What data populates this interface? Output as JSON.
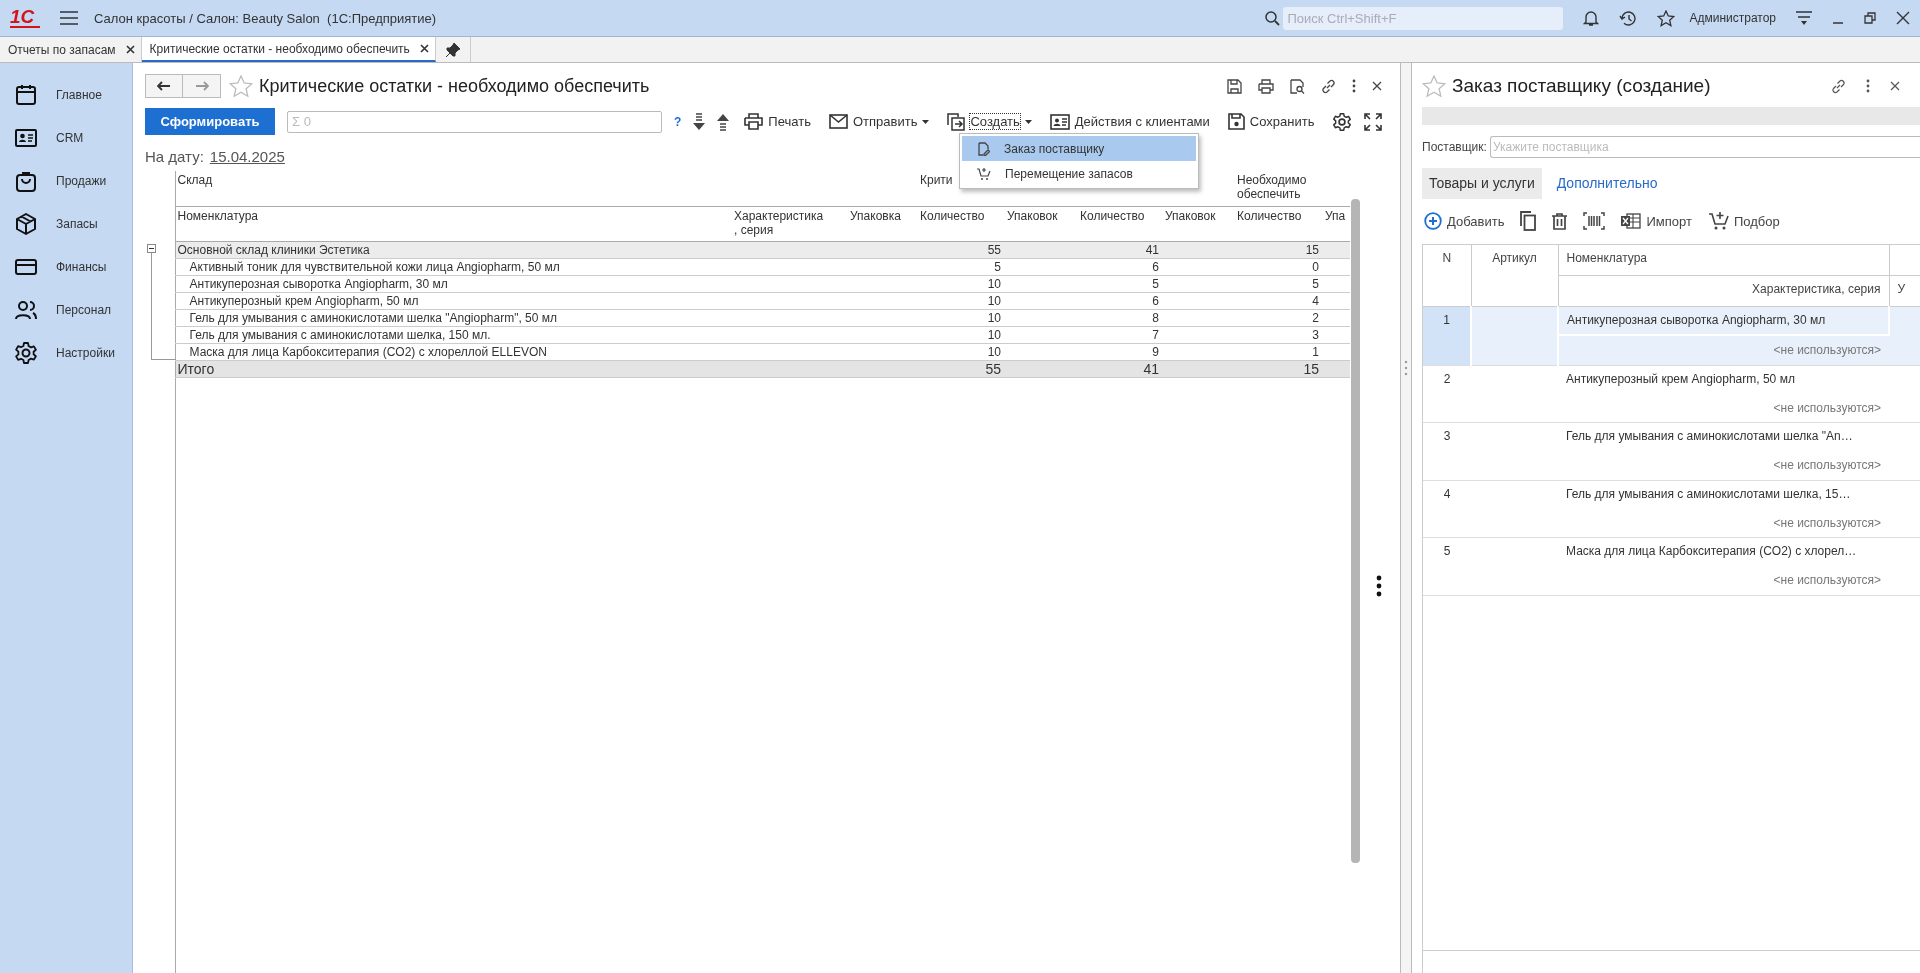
{
  "app": {
    "logo": "1С",
    "title": "Салон красоты / Салон: Beauty Salon  (1С:Предприятие)",
    "search_placeholder": "Поиск Ctrl+Shift+F",
    "user": "Администратор"
  },
  "open_tabs": [
    {
      "label": "Отчеты по запасам",
      "selected": false
    },
    {
      "label": "Критические остатки - необходимо обеспечить",
      "selected": true
    }
  ],
  "sidebar": {
    "items": [
      {
        "label": "Главное"
      },
      {
        "label": "CRM"
      },
      {
        "label": "Продажи"
      },
      {
        "label": "Запасы"
      },
      {
        "label": "Финансы"
      },
      {
        "label": "Персонал"
      },
      {
        "label": "Настройки"
      }
    ]
  },
  "report": {
    "title": "Критические остатки - необходимо обеспечить",
    "generate_button": "Сформировать",
    "sum_placeholder": "Σ 0",
    "help": "?",
    "toolbar": [
      {
        "kind": "print",
        "label": "Печать",
        "dropdown": false,
        "focused": false
      },
      {
        "kind": "send",
        "label": "Отправить",
        "dropdown": true,
        "focused": false
      },
      {
        "kind": "create",
        "label": "Создать",
        "dropdown": true,
        "focused": true
      },
      {
        "kind": "clients",
        "label": "Действия с клиентами",
        "dropdown": false,
        "focused": false
      },
      {
        "kind": "save",
        "label": "Сохранить",
        "dropdown": false,
        "focused": false
      }
    ],
    "menu": [
      {
        "kind": "order",
        "label": "Заказ поставщику",
        "selected": true
      },
      {
        "kind": "transfer",
        "label": "Перемещение запасов",
        "selected": false
      }
    ],
    "date_label": "На дату:",
    "date": "15.04.2025",
    "table": {
      "group_headers": {
        "warehouse": "Склад",
        "critical": "Крити",
        "need": "Необходимо обеспечить"
      },
      "columns": [
        "Номенклатура",
        "Характеристика\n, серия",
        "Упаковка",
        "Количество",
        "Упаковок",
        "Количество",
        "Упаковок",
        "Количество",
        "Упа"
      ],
      "group": {
        "name": "Основной склад клиники Эстетика",
        "expanded": true,
        "values": [
          "55",
          "41",
          "15"
        ]
      },
      "rows": [
        {
          "name": "Активный тоник для чувствительной кожи лица Angiopharm, 50 мл",
          "values": [
            "5",
            "6",
            "0"
          ]
        },
        {
          "name": "Антикуперозная сыворотка Angiopharm, 30 мл",
          "values": [
            "10",
            "5",
            "5"
          ]
        },
        {
          "name": "Антикуперозный крем Angiopharm, 50 мл",
          "values": [
            "10",
            "6",
            "4"
          ]
        },
        {
          "name": "Гель для умывания с аминокислотами шелка \"Angiopharm\", 50 мл",
          "values": [
            "10",
            "8",
            "2"
          ]
        },
        {
          "name": "Гель для умывания с аминокислотами шелка, 150 мл.",
          "values": [
            "10",
            "7",
            "3"
          ]
        },
        {
          "name": "Маска для лица Карбокситерапия (CO2) с хлореллой ELLEVON",
          "values": [
            "10",
            "9",
            "1"
          ]
        }
      ],
      "total": {
        "label": "Итого",
        "values": [
          "55",
          "41",
          "15"
        ]
      }
    }
  },
  "order": {
    "title": "Заказ поставщику (создание)",
    "supplier_label": "Поставщик:",
    "supplier_placeholder": "Укажите поставщика",
    "tabs": [
      {
        "label": "Товары и услуги",
        "selected": true
      },
      {
        "label": "Дополнительно",
        "selected": false
      }
    ],
    "toolbar": [
      {
        "kind": "add",
        "label": "Добавить"
      },
      {
        "kind": "copy"
      },
      {
        "kind": "delete"
      },
      {
        "kind": "barcode"
      },
      {
        "kind": "import",
        "label": "Импорт"
      },
      {
        "kind": "pick",
        "label": "Подбор"
      }
    ],
    "columns": {
      "n": "N",
      "article": "Артикул",
      "item": "Номенклатура",
      "characteristic": "Характеристика, серия",
      "column_4_sub": "У"
    },
    "rows": [
      {
        "n": "1",
        "name": "Антикуперозная сыворотка Angiopharm, 30 мл",
        "characteristic": "<не используются>",
        "selected": true
      },
      {
        "n": "2",
        "name": "Антикуперозный крем Angiopharm, 50 мл",
        "characteristic": "<не используются>",
        "selected": false
      },
      {
        "n": "3",
        "name": "Гель для умывания с аминокислотами шелка \"An…",
        "characteristic": "<не используются>",
        "selected": false
      },
      {
        "n": "4",
        "name": "Гель для умывания с аминокислотами шелка, 15…",
        "characteristic": "<не используются>",
        "selected": false
      },
      {
        "n": "5",
        "name": "Маска для лица Карбокситерапия (CO2) с хлорел…",
        "characteristic": "<не используются>",
        "selected": false
      }
    ]
  }
}
